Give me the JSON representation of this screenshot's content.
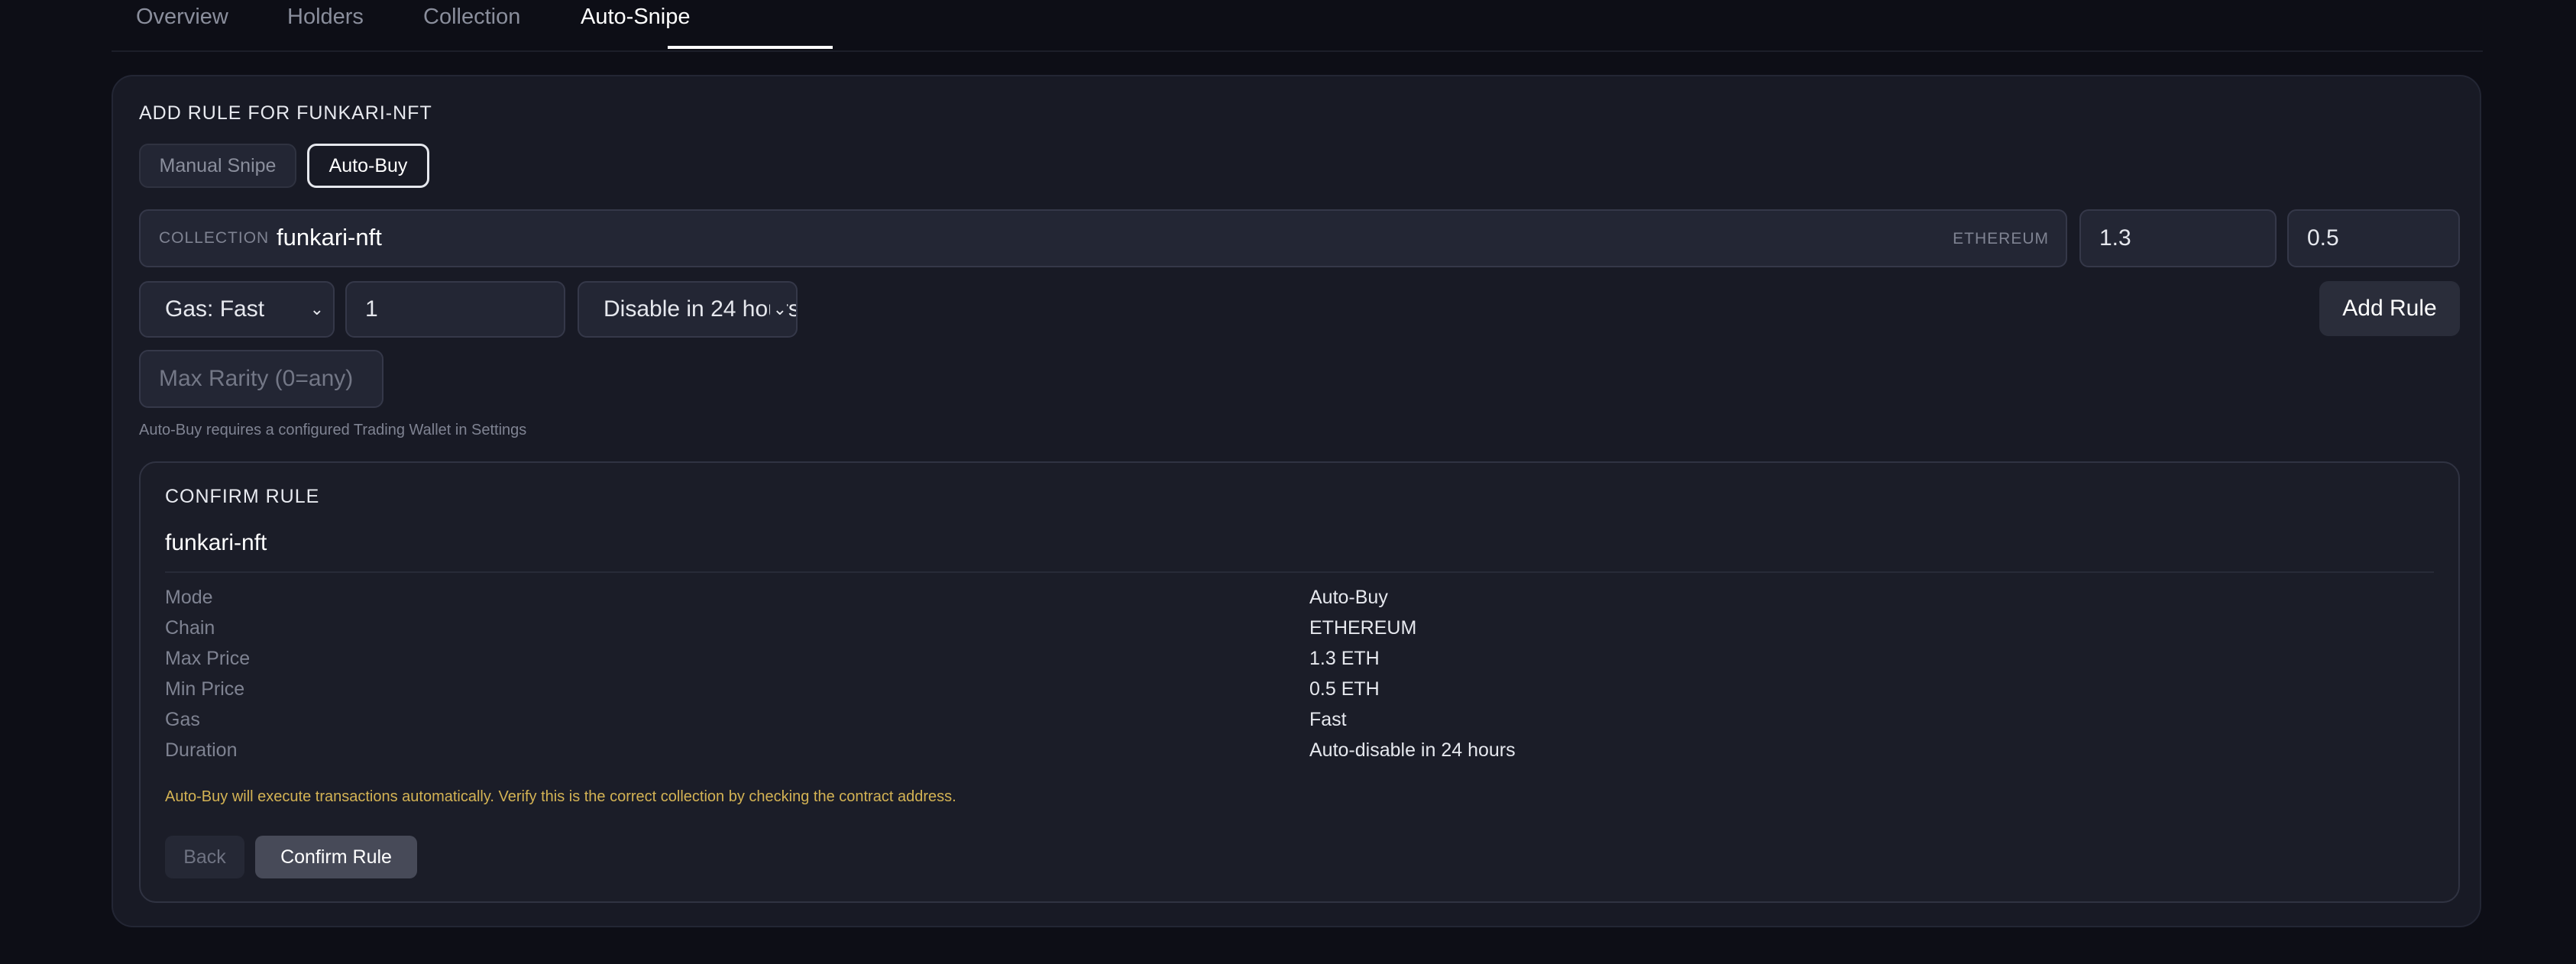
{
  "tabs": [
    {
      "label": "Overview"
    },
    {
      "label": "Holders"
    },
    {
      "label": "Collection"
    },
    {
      "label": "Auto-Snipe"
    }
  ],
  "active_tab": "Auto-Snipe",
  "form": {
    "heading": "ADD RULE FOR FUNKARI-NFT",
    "modes": {
      "manual": "Manual Snipe",
      "auto": "Auto-Buy"
    },
    "selected_mode": "Auto-Buy",
    "collection": {
      "label": "COLLECTION",
      "value": "funkari-nft",
      "chain": "ETHEREUM"
    },
    "max_price": "1.3",
    "min_price": "0.5",
    "gas_select": "Gas: Fast",
    "quantity": "1",
    "duration_select": "Disable in 24 hours",
    "add_rule_label": "Add Rule",
    "rarity_placeholder": "Max Rarity (0=any)",
    "hint": "Auto-Buy requires a configured Trading Wallet in Settings"
  },
  "confirm": {
    "title": "CONFIRM RULE",
    "collection_name": "funkari-nft",
    "rows": [
      {
        "label": "Mode",
        "value": "Auto-Buy"
      },
      {
        "label": "Chain",
        "value": "ETHEREUM"
      },
      {
        "label": "Max Price",
        "value": "1.3 ETH"
      },
      {
        "label": "Min Price",
        "value": "0.5 ETH"
      },
      {
        "label": "Gas",
        "value": "Fast"
      },
      {
        "label": "Duration",
        "value": "Auto-disable in 24 hours"
      }
    ],
    "warning": "Auto-Buy will execute transactions automatically. Verify this is the correct collection by checking the contract address.",
    "back_label": "Back",
    "confirm_label": "Confirm Rule"
  },
  "colors": {
    "background": "#0d0e16",
    "panel": "#181a25",
    "warning": "#d4b354",
    "active": "#ffffff"
  }
}
